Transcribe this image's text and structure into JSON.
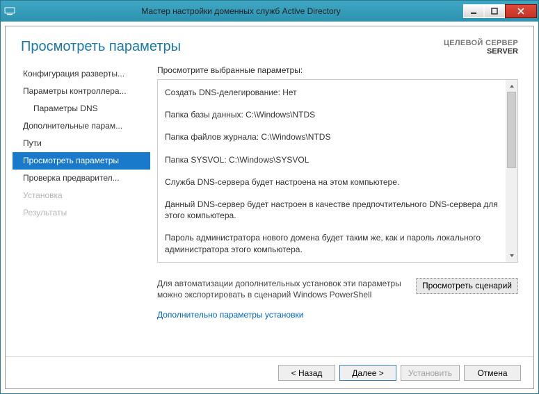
{
  "titlebar": {
    "title": "Мастер настройки доменных служб Active Directory"
  },
  "header": {
    "page_title": "Просмотреть параметры",
    "target_label": "ЦЕЛЕВОЙ СЕРВЕР",
    "target_value": "SERVER"
  },
  "nav": {
    "items": [
      {
        "label": "Конфигурация разверты...",
        "indent": false,
        "selected": false,
        "disabled": false
      },
      {
        "label": "Параметры контроллера...",
        "indent": false,
        "selected": false,
        "disabled": false
      },
      {
        "label": "Параметры DNS",
        "indent": true,
        "selected": false,
        "disabled": false
      },
      {
        "label": "Дополнительные парам...",
        "indent": false,
        "selected": false,
        "disabled": false
      },
      {
        "label": "Пути",
        "indent": false,
        "selected": false,
        "disabled": false
      },
      {
        "label": "Просмотреть параметры",
        "indent": false,
        "selected": true,
        "disabled": false
      },
      {
        "label": "Проверка предварител...",
        "indent": false,
        "selected": false,
        "disabled": false
      },
      {
        "label": "Установка",
        "indent": false,
        "selected": false,
        "disabled": true
      },
      {
        "label": "Результаты",
        "indent": false,
        "selected": false,
        "disabled": true
      }
    ]
  },
  "main": {
    "intro": "Просмотрите выбранные параметры:",
    "params": [
      "Создать DNS-делегирование: Нет",
      "Папка базы данных: C:\\Windows\\NTDS",
      "Папка файлов журнала: C:\\Windows\\NTDS",
      "Папка SYSVOL: C:\\Windows\\SYSVOL",
      "Служба DNS-сервера будет настроена на этом компьютере.",
      "Данный DNS-сервер будет настроен в качестве предпочтительного DNS-сервера для этого компьютера.",
      "Пароль администратора нового домена будет таким же, как и пароль локального администратора этого компьютера."
    ],
    "export_hint": "Для автоматизации дополнительных установок эти параметры можно экспортировать в сценарий Windows PowerShell",
    "view_script_btn": "Просмотреть сценарий",
    "more_link": "Дополнительно параметры установки"
  },
  "footer": {
    "back": "< Назад",
    "next": "Далее >",
    "install": "Установить",
    "cancel": "Отмена"
  }
}
